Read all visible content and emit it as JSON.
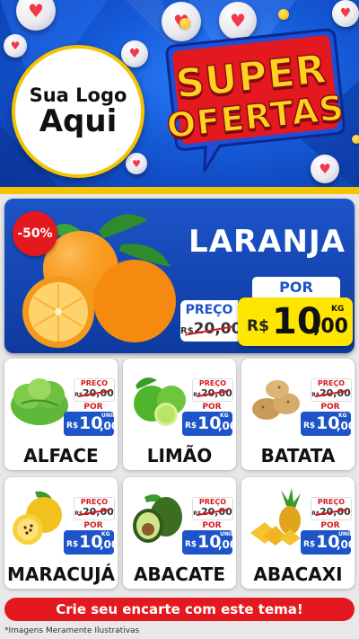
{
  "header": {
    "logo_line1": "Sua Logo",
    "logo_line2": "Aqui",
    "badge_line1": "SUPER",
    "badge_line2": "OFERTAS"
  },
  "featured": {
    "discount": "-50%",
    "name": "LARANJA",
    "preco_label": "PREÇO",
    "old_currency": "R$",
    "old_price": "20,00",
    "por_label": "POR",
    "currency": "R$",
    "price_int": "10",
    "price_dec": ",00",
    "unit": "KG"
  },
  "products": [
    {
      "name": "ALFACE",
      "preco_label": "PREÇO",
      "old_currency": "R$",
      "old_price": "20,00",
      "por_label": "POR",
      "currency": "R$",
      "price_int": "10",
      "price_dec": ",00",
      "unit": "UNID"
    },
    {
      "name": "LIMÃO",
      "preco_label": "PREÇO",
      "old_currency": "R$",
      "old_price": "20,00",
      "por_label": "POR",
      "currency": "R$",
      "price_int": "10",
      "price_dec": ",00",
      "unit": "KG"
    },
    {
      "name": "BATATA",
      "preco_label": "PREÇO",
      "old_currency": "R$",
      "old_price": "20,00",
      "por_label": "POR",
      "currency": "R$",
      "price_int": "10",
      "price_dec": ",00",
      "unit": "KG"
    },
    {
      "name": "MARACUJÁ",
      "preco_label": "PREÇO",
      "old_currency": "R$",
      "old_price": "20,00",
      "por_label": "POR",
      "currency": "R$",
      "price_int": "10",
      "price_dec": ",00",
      "unit": "KG"
    },
    {
      "name": "ABACATE",
      "preco_label": "PREÇO",
      "old_currency": "R$",
      "old_price": "20,00",
      "por_label": "POR",
      "currency": "R$",
      "price_int": "10",
      "price_dec": ",00",
      "unit": "UNID"
    },
    {
      "name": "ABACAXI",
      "preco_label": "PREÇO",
      "old_currency": "R$",
      "old_price": "20,00",
      "por_label": "POR",
      "currency": "R$",
      "price_int": "10",
      "price_dec": ",00",
      "unit": "UNID"
    }
  ],
  "cta": "Crie seu encarte com este tema!",
  "footnote": "*Imagens Meramente Ilustrativas",
  "colors": {
    "brand_blue": "#1d54c8",
    "accent_yellow": "#ffe600",
    "accent_red": "#e3191f"
  }
}
